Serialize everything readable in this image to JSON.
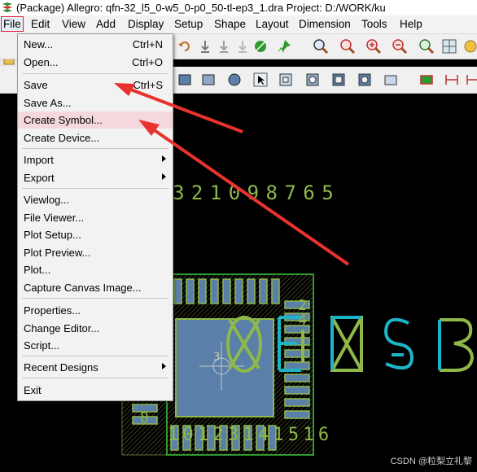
{
  "window": {
    "title": "(Package) Allegro: qfn-32_l5_0-w5_0-p0_50-tl-ep3_1.dra  Project: D:/WORK/ku"
  },
  "menubar": {
    "items": [
      {
        "label": "File",
        "active": true
      },
      {
        "label": "Edit"
      },
      {
        "label": "View"
      },
      {
        "label": "Add"
      },
      {
        "label": "Display"
      },
      {
        "label": "Setup"
      },
      {
        "label": "Shape"
      },
      {
        "label": "Layout"
      },
      {
        "label": "Dimension"
      },
      {
        "label": "Tools"
      },
      {
        "label": "Help"
      }
    ]
  },
  "file_menu": {
    "items": [
      {
        "label": "New...",
        "shortcut": "Ctrl+N"
      },
      {
        "label": "Open...",
        "shortcut": "Ctrl+O"
      },
      {
        "label": "Save",
        "shortcut": "Ctrl+S"
      },
      {
        "label": "Save As..."
      },
      {
        "label": "Create Symbol...",
        "highlighted": true
      },
      {
        "label": "Create Device..."
      },
      {
        "label": "Import",
        "submenu": true
      },
      {
        "label": "Export",
        "submenu": true
      },
      {
        "label": "Viewlog..."
      },
      {
        "label": "File Viewer..."
      },
      {
        "label": "Plot Setup..."
      },
      {
        "label": "Plot Preview..."
      },
      {
        "label": "Plot..."
      },
      {
        "label": "Capture Canvas Image..."
      },
      {
        "label": "Properties..."
      },
      {
        "label": "Change Editor..."
      },
      {
        "label": "Script..."
      },
      {
        "label": "Recent Designs",
        "submenu": true
      },
      {
        "label": "Exit"
      }
    ]
  },
  "canvas": {
    "top_pin_numbers": "3 2 1 0 9 8 7 6 5",
    "bottom_pin_numbers": "1 0 1 2 3 1 4 1 5 1 6",
    "right_pin_numbers": [
      "2",
      "4"
    ],
    "left_pin_number": "8",
    "center_marker": "3"
  },
  "watermark": "CSDN @粒梨立礼黎",
  "colors": {
    "arrow": "#e8322e",
    "pad": "#5a7fa8",
    "silkscreen": "#8fb84a",
    "outline": "#2f9a2f",
    "text_cyan": "#1eb4c8"
  }
}
